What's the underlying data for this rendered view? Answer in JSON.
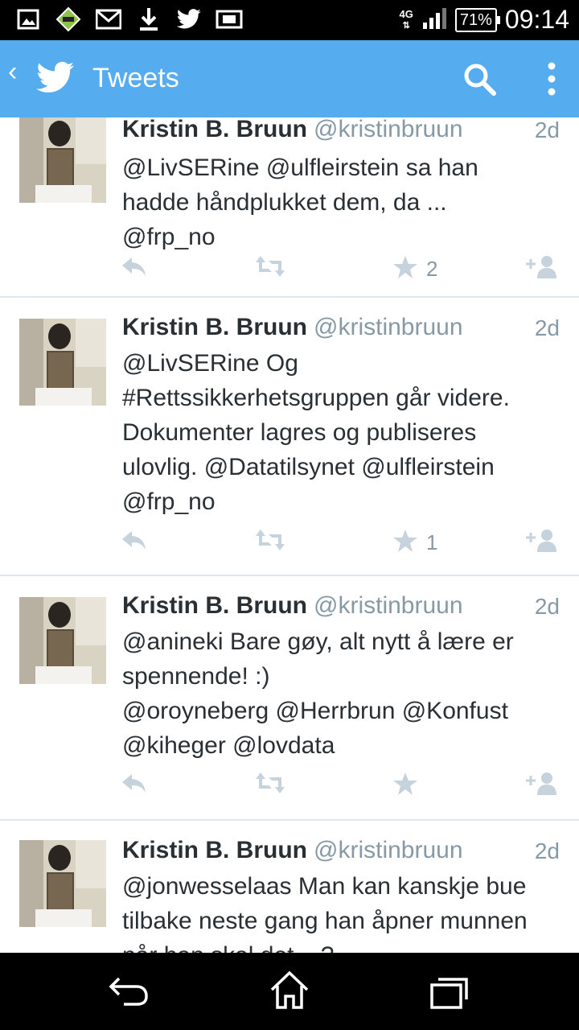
{
  "status_bar": {
    "network": "4G",
    "battery": "71%",
    "time": "09:14"
  },
  "app_bar": {
    "title": "Tweets"
  },
  "tweets": [
    {
      "name": "Kristin B. Bruun",
      "handle": "@kristinbruun",
      "time": "2d",
      "text": "@LivSERine @ulfleirstein sa han\nhadde håndplukket dem, da ...\n @frp_no",
      "favorites": "2"
    },
    {
      "name": "Kristin B. Bruun",
      "handle": "@kristinbruun",
      "time": "2d",
      "text": "@LivSERine Og\n#Rettssikkerhetsgruppen går videre.\nDokumenter lagres  og publiseres\nulovlig. @Datatilsynet @ulfleirstein\n@frp_no",
      "favorites": "1"
    },
    {
      "name": "Kristin B. Bruun",
      "handle": "@kristinbruun",
      "time": "2d",
      "text": "@anineki Bare gøy, alt nytt å lære er\nspennende! :)\n@oroyneberg @Herrbrun @Konfust\n@kiheger @lovdata",
      "favorites": ""
    },
    {
      "name": "Kristin B. Bruun",
      "handle": "@kristinbruun",
      "time": "2d",
      "text": "@jonwesselaas Man kan kanskje bue\ntilbake neste gang han åpner munnen\nnår han skal det ...?",
      "favorites": ""
    }
  ],
  "icons": {
    "status_left": [
      "gallery-icon",
      "app-icon",
      "gmail-icon",
      "download-icon",
      "twitter-icon",
      "info-icon"
    ],
    "action_color": "#c6d2dc",
    "accent": "#55acee"
  }
}
